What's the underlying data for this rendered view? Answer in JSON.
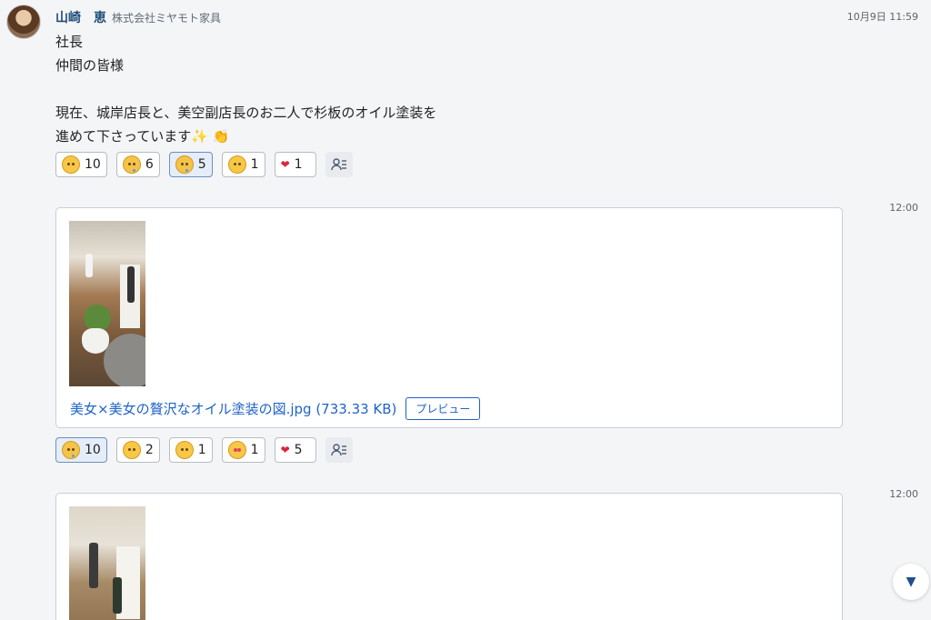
{
  "message": {
    "sender_name": "山崎　恵",
    "company": "株式会社ミヤモト家具",
    "timestamp": "10月9日 11:59",
    "lines": [
      "社長",
      "仲間の皆様",
      "",
      "現在、城岸店長と、美空副店長のお二人で杉板のオイル塗装を",
      "進めて下さっています✨ 👏"
    ],
    "reactions": [
      {
        "icon": "grinning-sweat-icon",
        "count": "10",
        "active": false
      },
      {
        "icon": "crying-laughing-icon",
        "count": "6",
        "active": false
      },
      {
        "icon": "tearful-smile-icon",
        "count": "5",
        "active": true
      },
      {
        "icon": "smile-icon",
        "count": "1",
        "active": false
      },
      {
        "icon": "heart-icon",
        "count": "1",
        "active": false
      }
    ]
  },
  "post2": {
    "timestamp": "12:00",
    "file_name": "美女×美女の贅沢なオイル塗装の図.jpg (733.33 KB)",
    "preview_label": "プレビュー",
    "reactions": [
      {
        "icon": "tearful-smile-icon",
        "count": "10",
        "active": true
      },
      {
        "icon": "smile-icon",
        "count": "2",
        "active": false
      },
      {
        "icon": "smile-icon",
        "count": "1",
        "active": false
      },
      {
        "icon": "heart-eyes-icon",
        "count": "1",
        "active": false
      },
      {
        "icon": "heart-icon",
        "count": "5",
        "active": false
      }
    ]
  },
  "post3": {
    "timestamp": "12:00"
  }
}
